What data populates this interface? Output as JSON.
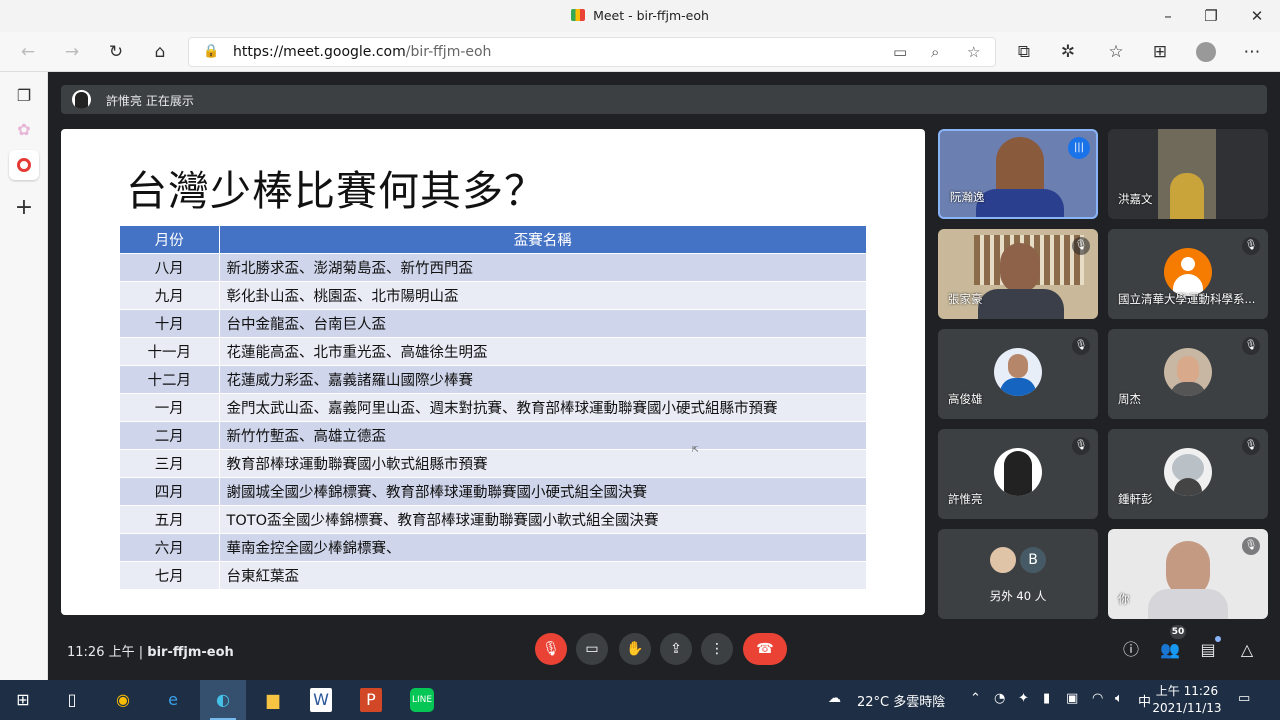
{
  "browser": {
    "window_title": "Meet - bir-ffjm-eoh",
    "url_host": "https://meet.google.com",
    "url_path": "/bir-ffjm-eoh"
  },
  "meet": {
    "presenting_text": "許惟亮 正在展示",
    "meeting_time": "11:26 上午",
    "meeting_code": "bir-ffjm-eoh",
    "people_count": "50"
  },
  "slide": {
    "title": "台灣少棒比賽何其多？",
    "header_month": "月份",
    "header_name": "盃賽名稱",
    "rows": [
      {
        "month": "八月",
        "name": "新北勝求盃、澎湖菊島盃、新竹西門盃"
      },
      {
        "month": "九月",
        "name": "彰化卦山盃、桃園盃、北市陽明山盃"
      },
      {
        "month": "十月",
        "name": "台中金龍盃、台南巨人盃"
      },
      {
        "month": "十一月",
        "name": "花蓮能高盃、北市重光盃、高雄徐生明盃"
      },
      {
        "month": "十二月",
        "name": "花蓮威力彩盃、嘉義諸羅山國際少棒賽"
      },
      {
        "month": "一月",
        "name": "金門太武山盃、嘉義阿里山盃、週末對抗賽、教育部棒球運動聯賽國小硬式組縣市預賽"
      },
      {
        "month": "二月",
        "name": "新竹竹塹盃、高雄立德盃"
      },
      {
        "month": "三月",
        "name": "教育部棒球運動聯賽國小軟式組縣市預賽"
      },
      {
        "month": "四月",
        "name": "謝國城全國少棒錦標賽、教育部棒球運動聯賽國小硬式組全國決賽"
      },
      {
        "month": "五月",
        "name": "TOTO盃全國少棒錦標賽、教育部棒球運動聯賽國小軟式組全國決賽"
      },
      {
        "month": "六月",
        "name": "華南金控全國少棒錦標賽、"
      },
      {
        "month": "七月",
        "name": "台東紅葉盃"
      }
    ]
  },
  "participants": [
    {
      "name": "阮瀚逸"
    },
    {
      "name": "洪嘉文"
    },
    {
      "name": "張家豪"
    },
    {
      "name": "國立清華大學運動科學系..."
    },
    {
      "name": "高俊雄"
    },
    {
      "name": "周杰"
    },
    {
      "name": "許惟亮"
    },
    {
      "name": "鍾軒彭"
    },
    {
      "name": "另外 40 人",
      "initial": "B"
    },
    {
      "name": "你"
    }
  ],
  "taskbar": {
    "weather": "22°C  多雲時陰",
    "ime": "中",
    "time": "上午 11:26",
    "date": "2021/11/13"
  },
  "colors": {
    "table_header": "#4472c4",
    "row_odd": "#cfd5ea",
    "row_even": "#e9ebf5",
    "hangup": "#ea4335",
    "meet_bg": "#202124"
  }
}
